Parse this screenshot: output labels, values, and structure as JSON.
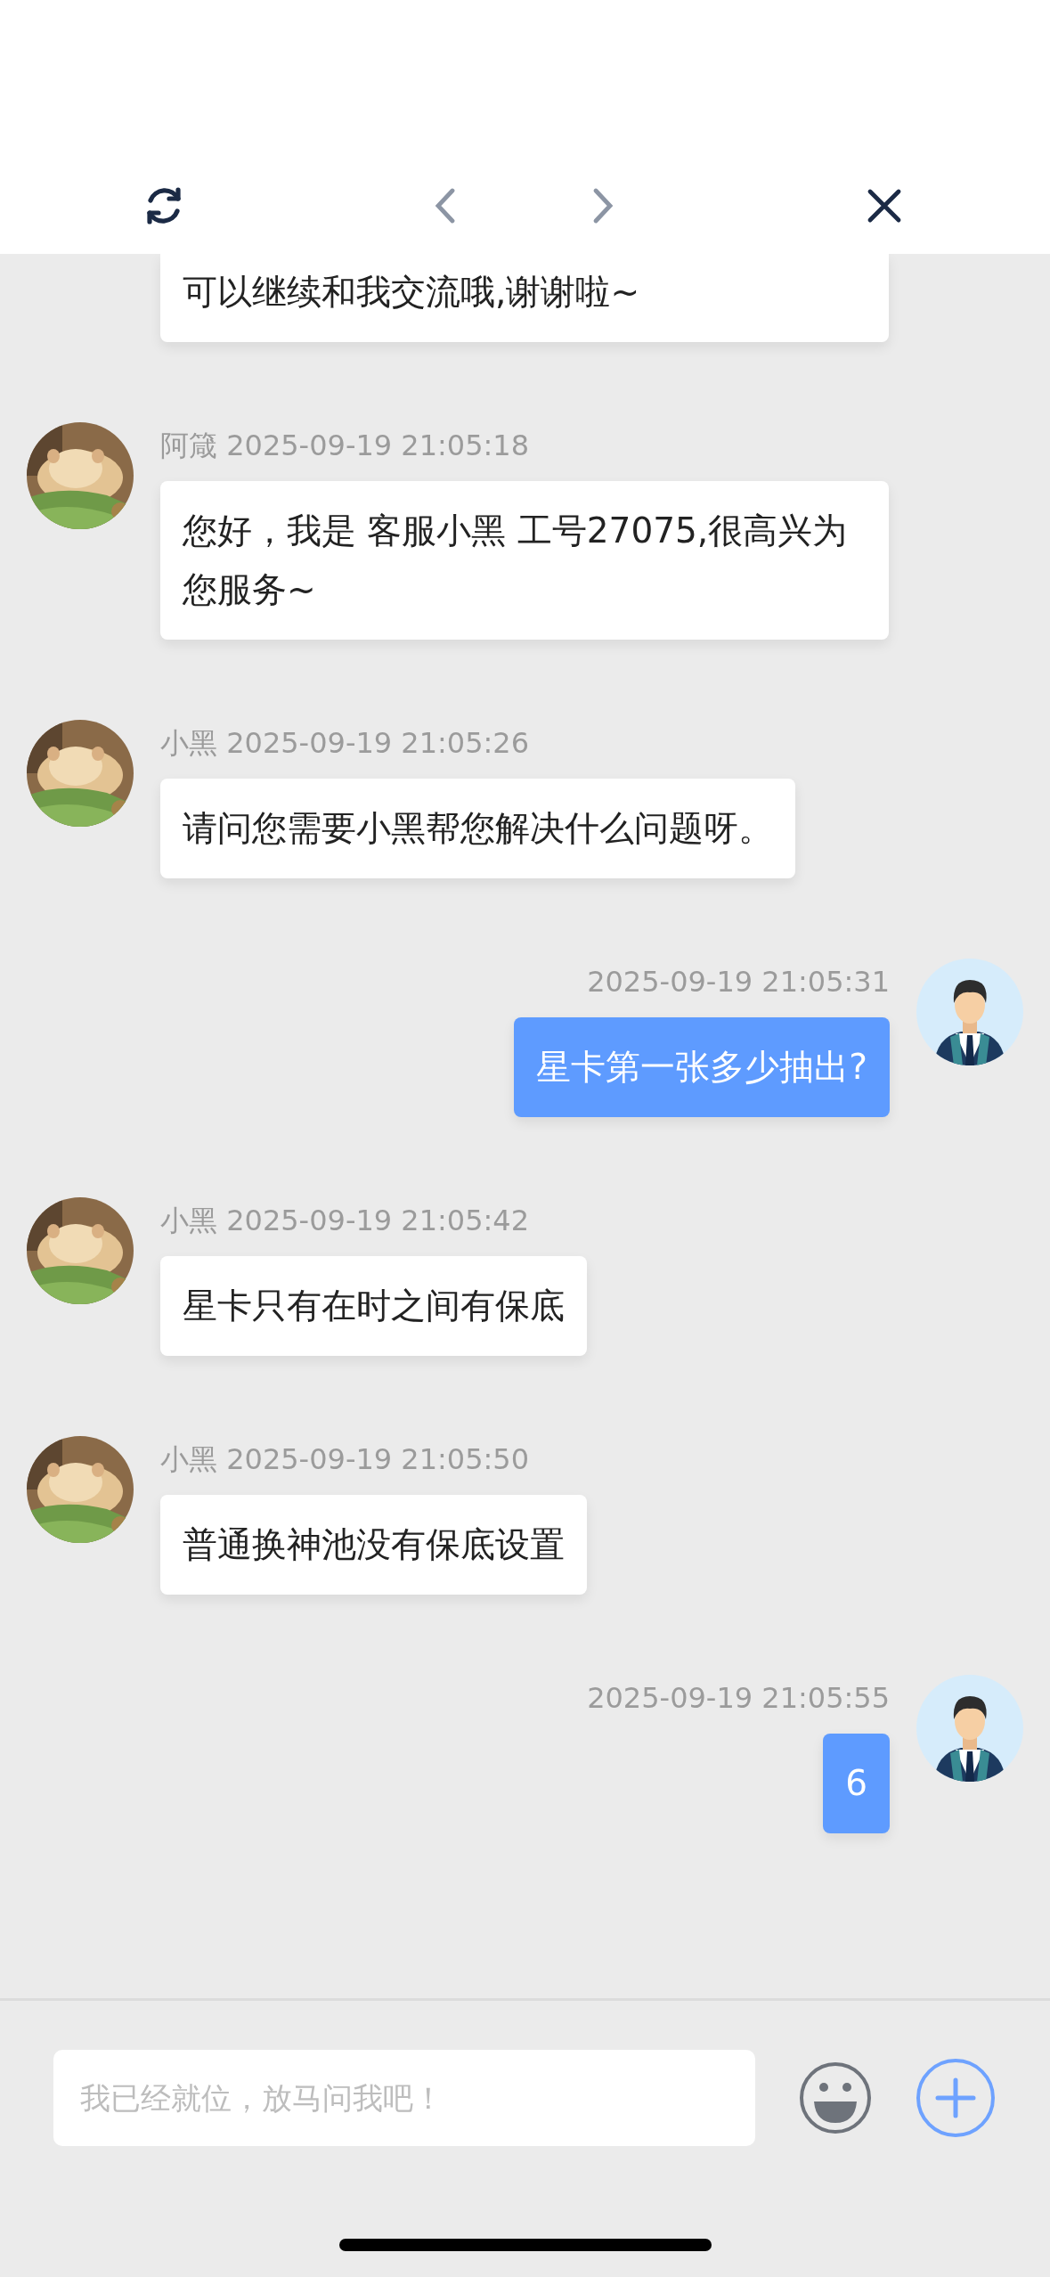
{
  "toolbar": [
    {
      "kind": "refresh",
      "disabled": false
    },
    {
      "kind": "back",
      "disabled": true
    },
    {
      "kind": "forward",
      "disabled": true
    },
    {
      "kind": "close",
      "disabled": false
    }
  ],
  "messages": [
    {
      "kind": "incoming",
      "text": "可以继续和我交流哦,谢谢啦~"
    },
    {
      "kind": "incoming",
      "sender": "阿箴",
      "time": "2025-09-19 21:05:18",
      "text": "您好，我是 客服小黑 工号27075,很高兴为您服务~"
    },
    {
      "kind": "incoming",
      "sender": "小黑",
      "time": "2025-09-19 21:05:26",
      "text": "请问您需要小黑帮您解决什么问题呀。"
    },
    {
      "kind": "outgoing",
      "time": "2025-09-19 21:05:31",
      "text": "星卡第一张多少抽出?"
    },
    {
      "kind": "incoming",
      "sender": "小黑",
      "time": "2025-09-19 21:05:42",
      "text": "星卡只有在时之间有保底"
    },
    {
      "kind": "incoming",
      "sender": "小黑",
      "time": "2025-09-19 21:05:50",
      "text": "普通换神池没有保底设置"
    },
    {
      "kind": "outgoing",
      "time": "2025-09-19 21:05:55",
      "text": "6"
    }
  ],
  "input": {
    "placeholder": "我已经就位，放马问我吧！"
  }
}
